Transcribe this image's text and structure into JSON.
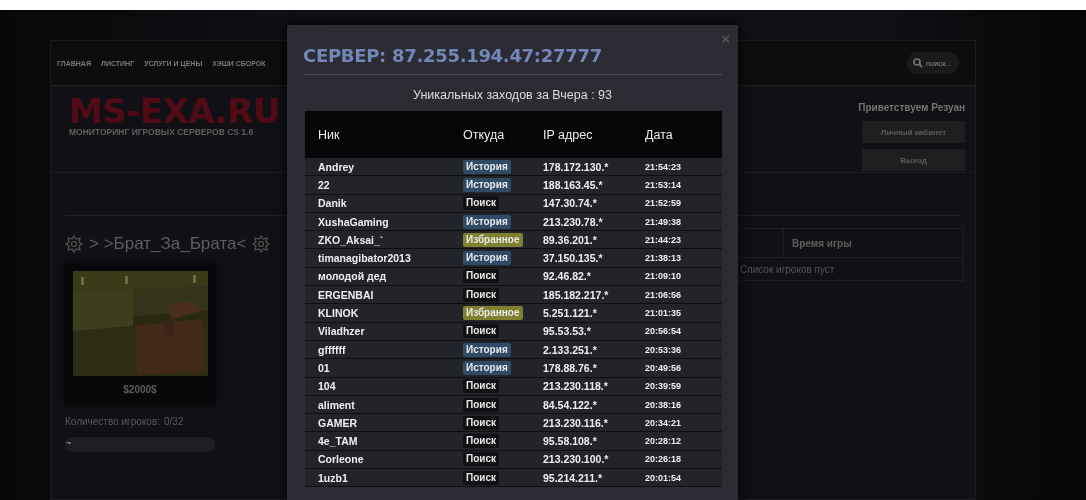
{
  "nav": {
    "items": [
      "ГЛАВНАЯ",
      "ЛИСТИНГ",
      "УСЛУГИ И ЦЕНЫ",
      "ХЭШИ СБОРОК"
    ],
    "search": {
      "placeholder": "поиск..."
    }
  },
  "logo": {
    "title": "MS-EXA.RU",
    "subtitle": "МОНИТОРИНГ ИГРОВЫХ СЕРВЕРОВ CS 1.6"
  },
  "user": {
    "greeting": "Приветствуем Резуан",
    "buttons": [
      "Личный кабинет",
      "Выход"
    ]
  },
  "server": {
    "title": "> >Брат_За_Брата<",
    "map_caption": "$2000$",
    "players_label": "Количество игроков:",
    "players": "0/32",
    "bar_text": "~"
  },
  "players_table": {
    "columns": [
      "",
      "Время игры"
    ],
    "empty": "Список игроков пуст"
  },
  "modal": {
    "title": "СЕРВЕР: 87.255.194.47:27777",
    "close": "×",
    "subtitle": "Уникальных заходов за Вчера : 93",
    "columns": [
      "Ник",
      "Откуда",
      "IP адрес",
      "Дата"
    ],
    "rows": [
      {
        "nick": "Andrey",
        "source": {
          "kind": "history",
          "label": "История"
        },
        "ip": "178.172.130.*",
        "date": "21:54:23"
      },
      {
        "nick": "22",
        "source": {
          "kind": "history",
          "label": "История"
        },
        "ip": "188.163.45.*",
        "date": "21:53:14"
      },
      {
        "nick": "Danik",
        "source": {
          "kind": "search",
          "label": "Поиск"
        },
        "ip": "147.30.74.*",
        "date": "21:52:59"
      },
      {
        "nick": "XushaGaming",
        "source": {
          "kind": "history",
          "label": "История"
        },
        "ip": "213.230.78.*",
        "date": "21:49:38"
      },
      {
        "nick": "ZKO_Aksai_`",
        "source": {
          "kind": "favorite",
          "label": "Избранное"
        },
        "ip": "89.36.201.*",
        "date": "21:44:23"
      },
      {
        "nick": "timanagibator2013",
        "source": {
          "kind": "history",
          "label": "История"
        },
        "ip": "37.150.135.*",
        "date": "21:38:13"
      },
      {
        "nick": "молодой дед",
        "source": {
          "kind": "search",
          "label": "Поиск"
        },
        "ip": "92.46.82.*",
        "date": "21:09:10"
      },
      {
        "nick": "ERGENBAI",
        "source": {
          "kind": "search",
          "label": "Поиск"
        },
        "ip": "185.182.217.*",
        "date": "21:06:56"
      },
      {
        "nick": "KLINOK",
        "source": {
          "kind": "favorite",
          "label": "Избранное"
        },
        "ip": "5.251.121.*",
        "date": "21:01:35"
      },
      {
        "nick": "Viladhzer",
        "source": {
          "kind": "search",
          "label": "Поиск"
        },
        "ip": "95.53.53.*",
        "date": "20:56:54"
      },
      {
        "nick": "gffffff",
        "source": {
          "kind": "history",
          "label": "История"
        },
        "ip": "2.133.251.*",
        "date": "20:53:36"
      },
      {
        "nick": "01",
        "source": {
          "kind": "history",
          "label": "История"
        },
        "ip": "178.88.76.*",
        "date": "20:49:56"
      },
      {
        "nick": "104",
        "source": {
          "kind": "search",
          "label": "Поиск"
        },
        "ip": "213.230.118.*",
        "date": "20:39:59"
      },
      {
        "nick": "aliment",
        "source": {
          "kind": "search",
          "label": "Поиск"
        },
        "ip": "84.54.122.*",
        "date": "20:38:16"
      },
      {
        "nick": "GAMER",
        "source": {
          "kind": "search",
          "label": "Поиск"
        },
        "ip": "213.230.116.*",
        "date": "20:34:21"
      },
      {
        "nick": "4e_TAM",
        "source": {
          "kind": "search",
          "label": "Поиск"
        },
        "ip": "95.58.108.*",
        "date": "20:28:12"
      },
      {
        "nick": "Corleone",
        "source": {
          "kind": "search",
          "label": "Поиск"
        },
        "ip": "213.230.100.*",
        "date": "20:26:18"
      },
      {
        "nick": "1uzb1",
        "source": {
          "kind": "search",
          "label": "Поиск"
        },
        "ip": "95.214.211.*",
        "date": "20:01:54"
      }
    ]
  }
}
